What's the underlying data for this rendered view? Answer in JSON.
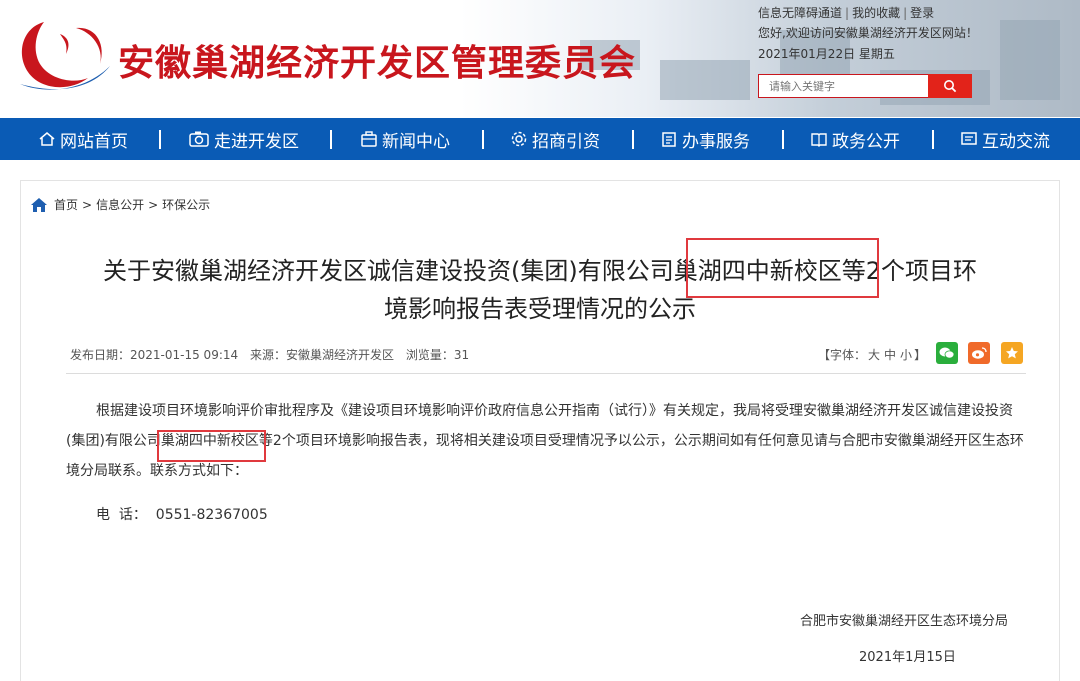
{
  "header": {
    "site_title": "安徽巢湖经济开发区管理委员会",
    "top_links": [
      "信息无障碍通道",
      "我的收藏",
      "登录"
    ],
    "welcome": "您好,欢迎访问安徽巢湖经济开发区网站！",
    "date": "2021年01月22日 星期五",
    "search_placeholder": "请输入关键字"
  },
  "nav": {
    "items": [
      {
        "label": "网站首页",
        "icon": "home-icon"
      },
      {
        "label": "走进开发区",
        "icon": "camera-icon"
      },
      {
        "label": "新闻中心",
        "icon": "briefcase-icon"
      },
      {
        "label": "招商引资",
        "icon": "gear-icon"
      },
      {
        "label": "办事服务",
        "icon": "clipboard-icon"
      },
      {
        "label": "政务公开",
        "icon": "book-icon"
      },
      {
        "label": "互动交流",
        "icon": "message-icon"
      }
    ]
  },
  "breadcrumb": {
    "items": [
      "首页",
      "信息公开",
      "环保公示"
    ],
    "separator": ">"
  },
  "article": {
    "title_line1": "关于安徽巢湖经济开发区诚信建设投资(集团)有限公司巢湖四中新校区等2个项目环",
    "title_line2": "境影响报告表受理情况的公示",
    "publish_date": "发布日期：2021-01-15 09:14",
    "source": "来源：安徽巢湖经济开发区",
    "views": "浏览量：31",
    "font_label": "【字体：",
    "font_sizes": [
      "大",
      "中",
      "小"
    ],
    "font_close": "】",
    "paragraph": "根据建设项目环境影响评价审批程序及《建设项目环境影响评价政府信息公开指南（试行）》有关规定，我局将受理安徽巢湖经济开发区诚信建设投资(集团)有限公司巢湖四中新校区等2个项目环境影响报告表，现将相关建设项目受理情况予以公示，公示期间如有任何意见请与合肥市安徽巢湖经开区生态环境分局联系。联系方式如下：",
    "tel": "电  话：  0551-82367005",
    "sign_org": "合肥市安徽巢湖经开区生态环境分局",
    "sign_date": "2021年1月15日"
  },
  "colors": {
    "brand_red": "#c8161d",
    "nav_blue": "#0a5bb5",
    "highlight_red": "#e0393e",
    "wechat_green": "#2aae3c",
    "weibo_orange": "#f06a2a",
    "star_orange": "#f5a623"
  }
}
